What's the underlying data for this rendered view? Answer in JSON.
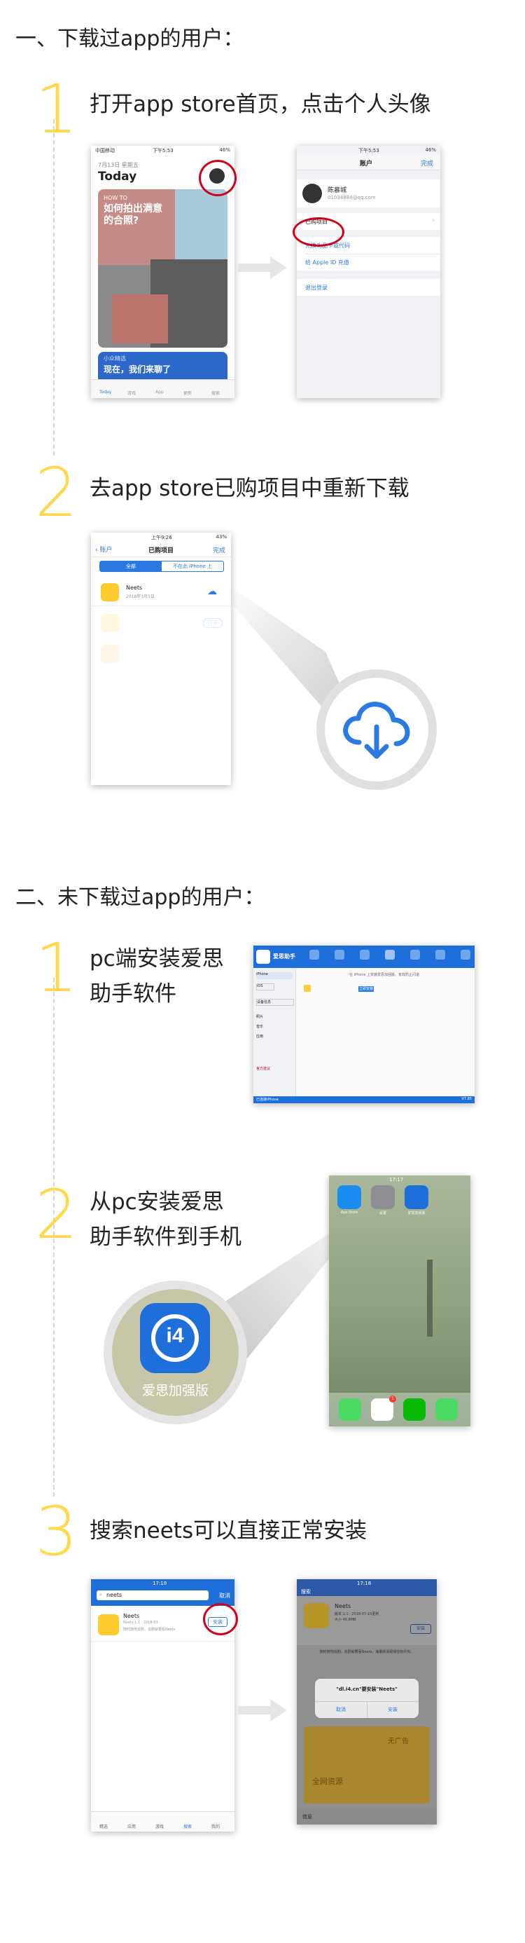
{
  "sections": [
    {
      "title": "一、下载过app的用户："
    },
    {
      "title": "二、未下载过app的用户："
    }
  ],
  "steps_a": [
    {
      "num": "1",
      "text": "打开app store首页，点击个人头像"
    },
    {
      "num": "2",
      "text": "去app store已购项目中重新下载"
    }
  ],
  "steps_b": [
    {
      "num": "1",
      "line1": "pc端安装爱思",
      "line2": "助手软件"
    },
    {
      "num": "2",
      "line1": "从pc安装爱思",
      "line2": "助手软件到手机"
    },
    {
      "num": "3",
      "text": "搜索neets可以直接正常安装"
    }
  ],
  "appstore": {
    "carrier": "中国移动",
    "time": "下午5:53",
    "battery": "46%",
    "date": "7月13日 星期五",
    "today": "Today",
    "card_tag": "HOW TO",
    "card_title": "如何拍出满意的合照?",
    "card2_tag": "小众精选",
    "card2_title": "现在，我们来聊了",
    "tabs": [
      "Today",
      "游戏",
      "App",
      "更新",
      "搜索"
    ]
  },
  "account": {
    "time": "下午5:53",
    "battery": "46%",
    "title": "账户",
    "done": "完成",
    "user_name": "陈慕城",
    "user_email": "01034884@qq.com",
    "purchased": "已购项目",
    "redeem": "兑换礼品卡或代码",
    "topup": "给 Apple ID 充值",
    "logout": "退出登录"
  },
  "purchased": {
    "time": "上午9:26",
    "battery": "43%",
    "back": "账户",
    "title": "已购项目",
    "done": "完成",
    "seg_all": "全部",
    "seg_notin": "不在此 iPhone 上",
    "app_name": "Neets",
    "app_date": "2018年3月1日",
    "open_label": "打开"
  },
  "i4pc": {
    "brand": "爱思助手",
    "tip": "在 iPhone 上安装爱思加强版，有效防止闪退",
    "install_btn": "立即安装",
    "status_tag": "已连接",
    "side_items": [
      "iPhone",
      "iOS",
      "设备信息",
      "照片",
      "音乐",
      "应用"
    ],
    "side_red": "官方建议",
    "footer_left": "已连接iPhone",
    "footer_right": "V7.85"
  },
  "home": {
    "time": "17:17",
    "apps": [
      "App Store",
      "设置",
      "爱思加强版"
    ],
    "badge": "1",
    "lens_label": "爱思加强版"
  },
  "search_phone": {
    "time": "17:18",
    "query": "neets",
    "cancel": "取消",
    "app_name": "Neets",
    "app_meta": "Neets 1.1 · 2018-03",
    "app_desc": "随时随地追剧，追剧就要看Neets",
    "install": "安装",
    "tabs": [
      "精选",
      "应用",
      "游戏",
      "搜索",
      "我的"
    ]
  },
  "install_phone": {
    "time": "17:18",
    "back": "搜索",
    "app_name": "Neets",
    "app_meta": "版本 1.1 · 2018-07-10更新",
    "app_size": "大小 46.8MB",
    "install": "安装",
    "desc": "随时随地追剧，追剧就要看Neets，海量高清视频应有尽有。",
    "alert_title": "\"dl.i4.cn\"要安装\"Neets\"",
    "cancel": "取消",
    "confirm": "安装",
    "promo1": "无广告",
    "promo2": "全网资源",
    "footer": "信息"
  },
  "colors": {
    "accent_yellow": "#ffd84d",
    "ios_blue": "#2b7ae2",
    "ring_red": "#d0021b",
    "i4_blue": "#1e6fd9"
  }
}
